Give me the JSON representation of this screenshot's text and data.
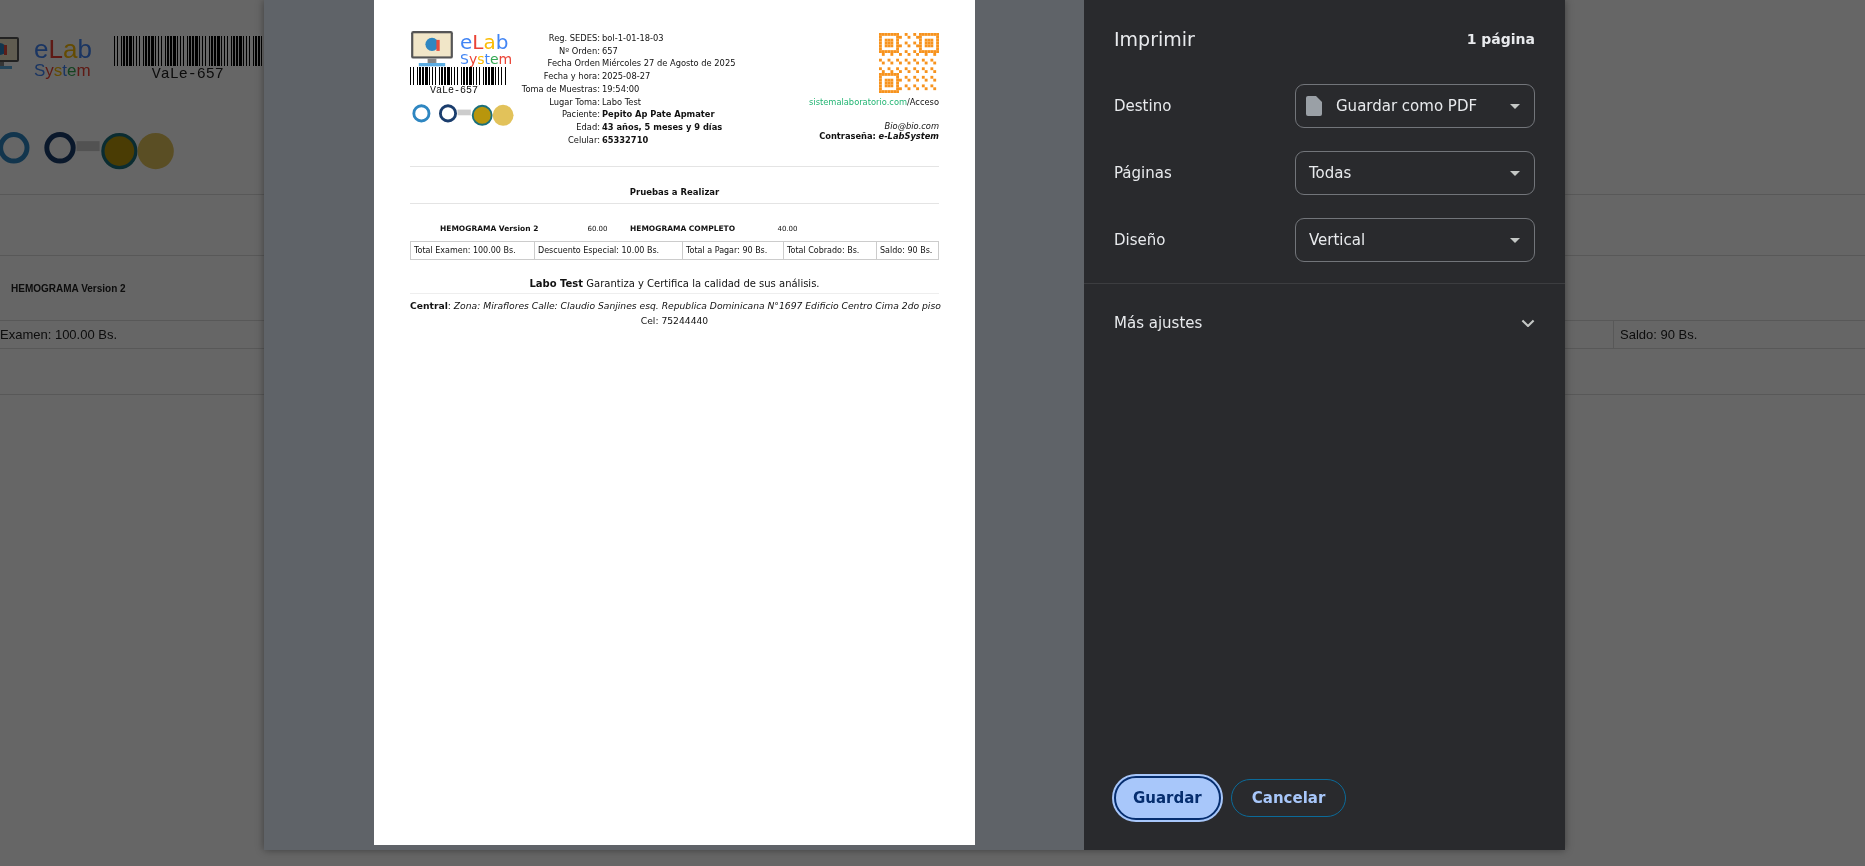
{
  "background_page": {
    "logo_word": "eLab",
    "logo_subword": "System",
    "barcode_text": "VaLe-657",
    "test_name": "HEMOGRAMA Version 2",
    "total_exam": "Examen: 100.00 Bs.",
    "balance": "Saldo: 90 Bs."
  },
  "print_preview": {
    "logo_word": "eLab",
    "logo_subword": "System",
    "barcode_text": "VaLe-657",
    "fields": [
      {
        "label": "Reg. SEDES:",
        "value": "bol-1-01-18-03",
        "bold": false
      },
      {
        "label": "Nº Orden:",
        "value": "657",
        "bold": false
      },
      {
        "label": "Fecha Orden",
        "value": "Miércoles 27 de Agosto de 2025",
        "bold": false
      },
      {
        "label": "Fecha y hora:",
        "value": "2025-08-27",
        "bold": false
      },
      {
        "label": "Toma de Muestras:",
        "value": "19:54:00",
        "bold": false
      },
      {
        "label": "Lugar Toma:",
        "value": "Labo Test",
        "bold": false
      },
      {
        "label": "Paciente:",
        "value": "Pepito Ap Pate Apmater",
        "bold": true
      },
      {
        "label": "Edad:",
        "value": "43 años, 5 meses y 9 días",
        "bold": true
      },
      {
        "label": "Celular:",
        "value": "65332710",
        "bold": true
      }
    ],
    "site_link": "sistemalaboratorio.com",
    "site_path": "/Acceso",
    "email": "Bio@bio.com",
    "password_label": "Contraseña:",
    "password": "e-LabSystem",
    "section_title": "Pruebas a Realizar",
    "tests": [
      {
        "name": "HEMOGRAMA Version 2",
        "price": "60.00"
      },
      {
        "name": "HEMOGRAMA COMPLETO",
        "price": "40.00"
      }
    ],
    "totals": [
      "Total Examen: 100.00 Bs.",
      "Descuento Especial: 10.00 Bs.",
      "Total a Pagar: 90 Bs.",
      "Total Cobrado: Bs.",
      "Saldo: 90 Bs."
    ],
    "guarantee": "**Labo Test** Garantiza y Certifica la calidad de sus análisis.",
    "address": "**Central**: *Zona: Miraflores Calle: Claudio Sanjines esq. Republica Dominicana N°1697 Edificio Centro Cima 2do piso*",
    "phone": "Cel: 75244440"
  },
  "print_panel": {
    "title": "Imprimir",
    "page_count": "1 página",
    "settings": [
      {
        "label": "Destino",
        "value": "Guardar como PDF",
        "kind": "with-icon"
      },
      {
        "label": "Páginas",
        "value": "Todas",
        "kind": "plain"
      },
      {
        "label": "Diseño",
        "value": "Vertical",
        "kind": "plain"
      }
    ],
    "more_settings": {
      "label": "Más ajustes",
      "expanded": false
    },
    "buttons": [
      {
        "label": "Guardar",
        "kind": "primary"
      },
      {
        "label": "Cancelar",
        "kind": "secondary"
      }
    ]
  }
}
